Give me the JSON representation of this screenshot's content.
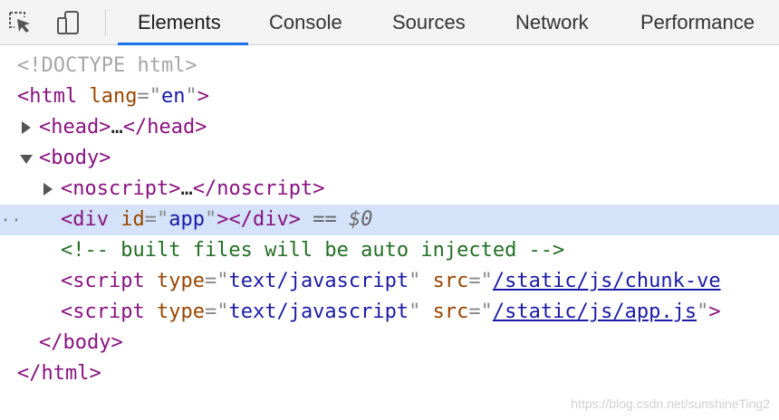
{
  "toolbar": {
    "icons": [
      "inspect-element-icon",
      "device-toolbar-icon"
    ],
    "tabs": [
      {
        "label": "Elements",
        "active": true
      },
      {
        "label": "Console",
        "active": false
      },
      {
        "label": "Sources",
        "active": false
      },
      {
        "label": "Network",
        "active": false
      },
      {
        "label": "Performance",
        "active": false
      }
    ],
    "accent_color": "#1a73e8"
  },
  "dom_tree": {
    "doctype": "<!DOCTYPE html>",
    "html_open": {
      "tag": "html",
      "attr": "lang",
      "value": "en"
    },
    "head": {
      "tag": "head",
      "ellipsis": "…"
    },
    "body_tag": "body",
    "noscript": {
      "tag": "noscript",
      "ellipsis": "…"
    },
    "selected_div": {
      "tag": "div",
      "attr": "id",
      "value": "app",
      "console_ref": "== $0",
      "gutter": "··"
    },
    "comment": "<!-- built files will be auto injected -->",
    "script1": {
      "tag": "script",
      "attr1": "type",
      "val1": "text/javascript",
      "attr2": "src",
      "val2": "/static/js/chunk-ve"
    },
    "script2": {
      "tag": "script",
      "attr1": "type",
      "val1": "text/javascript",
      "attr2": "src",
      "val2": "/static/js/app.js",
      "trail": ">"
    },
    "body_close": "body",
    "html_close": "html",
    "selection_color": "#d4e3f9"
  },
  "watermark": "https://blog.csdn.net/sunshineTing2"
}
